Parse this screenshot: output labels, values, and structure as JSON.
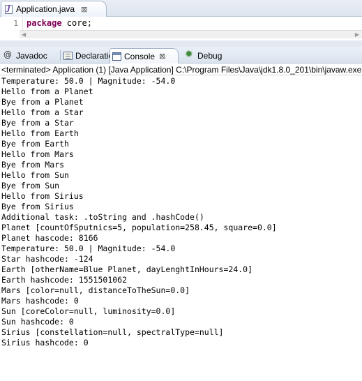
{
  "editor": {
    "tab": {
      "label": "Application.java",
      "close": "⊠"
    },
    "line_number": "1",
    "code": {
      "keyword": "package",
      "rest": " core;"
    }
  },
  "view": {
    "tabs": [
      {
        "label": "Javadoc",
        "icon": "javadoc-icon"
      },
      {
        "label": "Declaration",
        "icon": "declaration-icon"
      },
      {
        "label": "Console",
        "icon": "console-icon",
        "active": true
      },
      {
        "label": "Debug",
        "icon": "debug-icon"
      }
    ],
    "console_close": "⊠",
    "status": "<terminated> Application (1) [Java Application] C:\\Program Files\\Java\\jdk1.8.0_201\\bin\\javaw.exe",
    "output": [
      "Temperature: 50.0 | Magnitude: -54.0",
      "Hello from a Planet",
      "Bye from a Planet",
      "Hello from a Star",
      "Bye from a Star",
      "Hello from Earth",
      "Bye from Earth",
      "Hello from Mars",
      "Bye from Mars",
      "Hello from Sun",
      "Bye from Sun",
      "Hello from Sirius",
      "Bye from Sirius",
      "Additional task: .toString and .hashCode()",
      "Planet [countOfSputnics=5, population=258.45, square=0.0]",
      "Planet hascode: 8166",
      "Temperature: 50.0 | Magnitude: -54.0",
      "Star hashcode: -124",
      "Earth [otherName=Blue Planet, dayLenghtInHours=24.0]",
      "Earth hashcode: 1551501062",
      "Mars [color=null, distanceToTheSun=0.0]",
      "Mars hashcode: 0",
      "Sun [coreColor=null, luminosity=0.0]",
      "Sun hashcode: 0",
      "Sirius [constellation=null, spectralType=null]",
      "Sirius hashcode: 0"
    ]
  }
}
